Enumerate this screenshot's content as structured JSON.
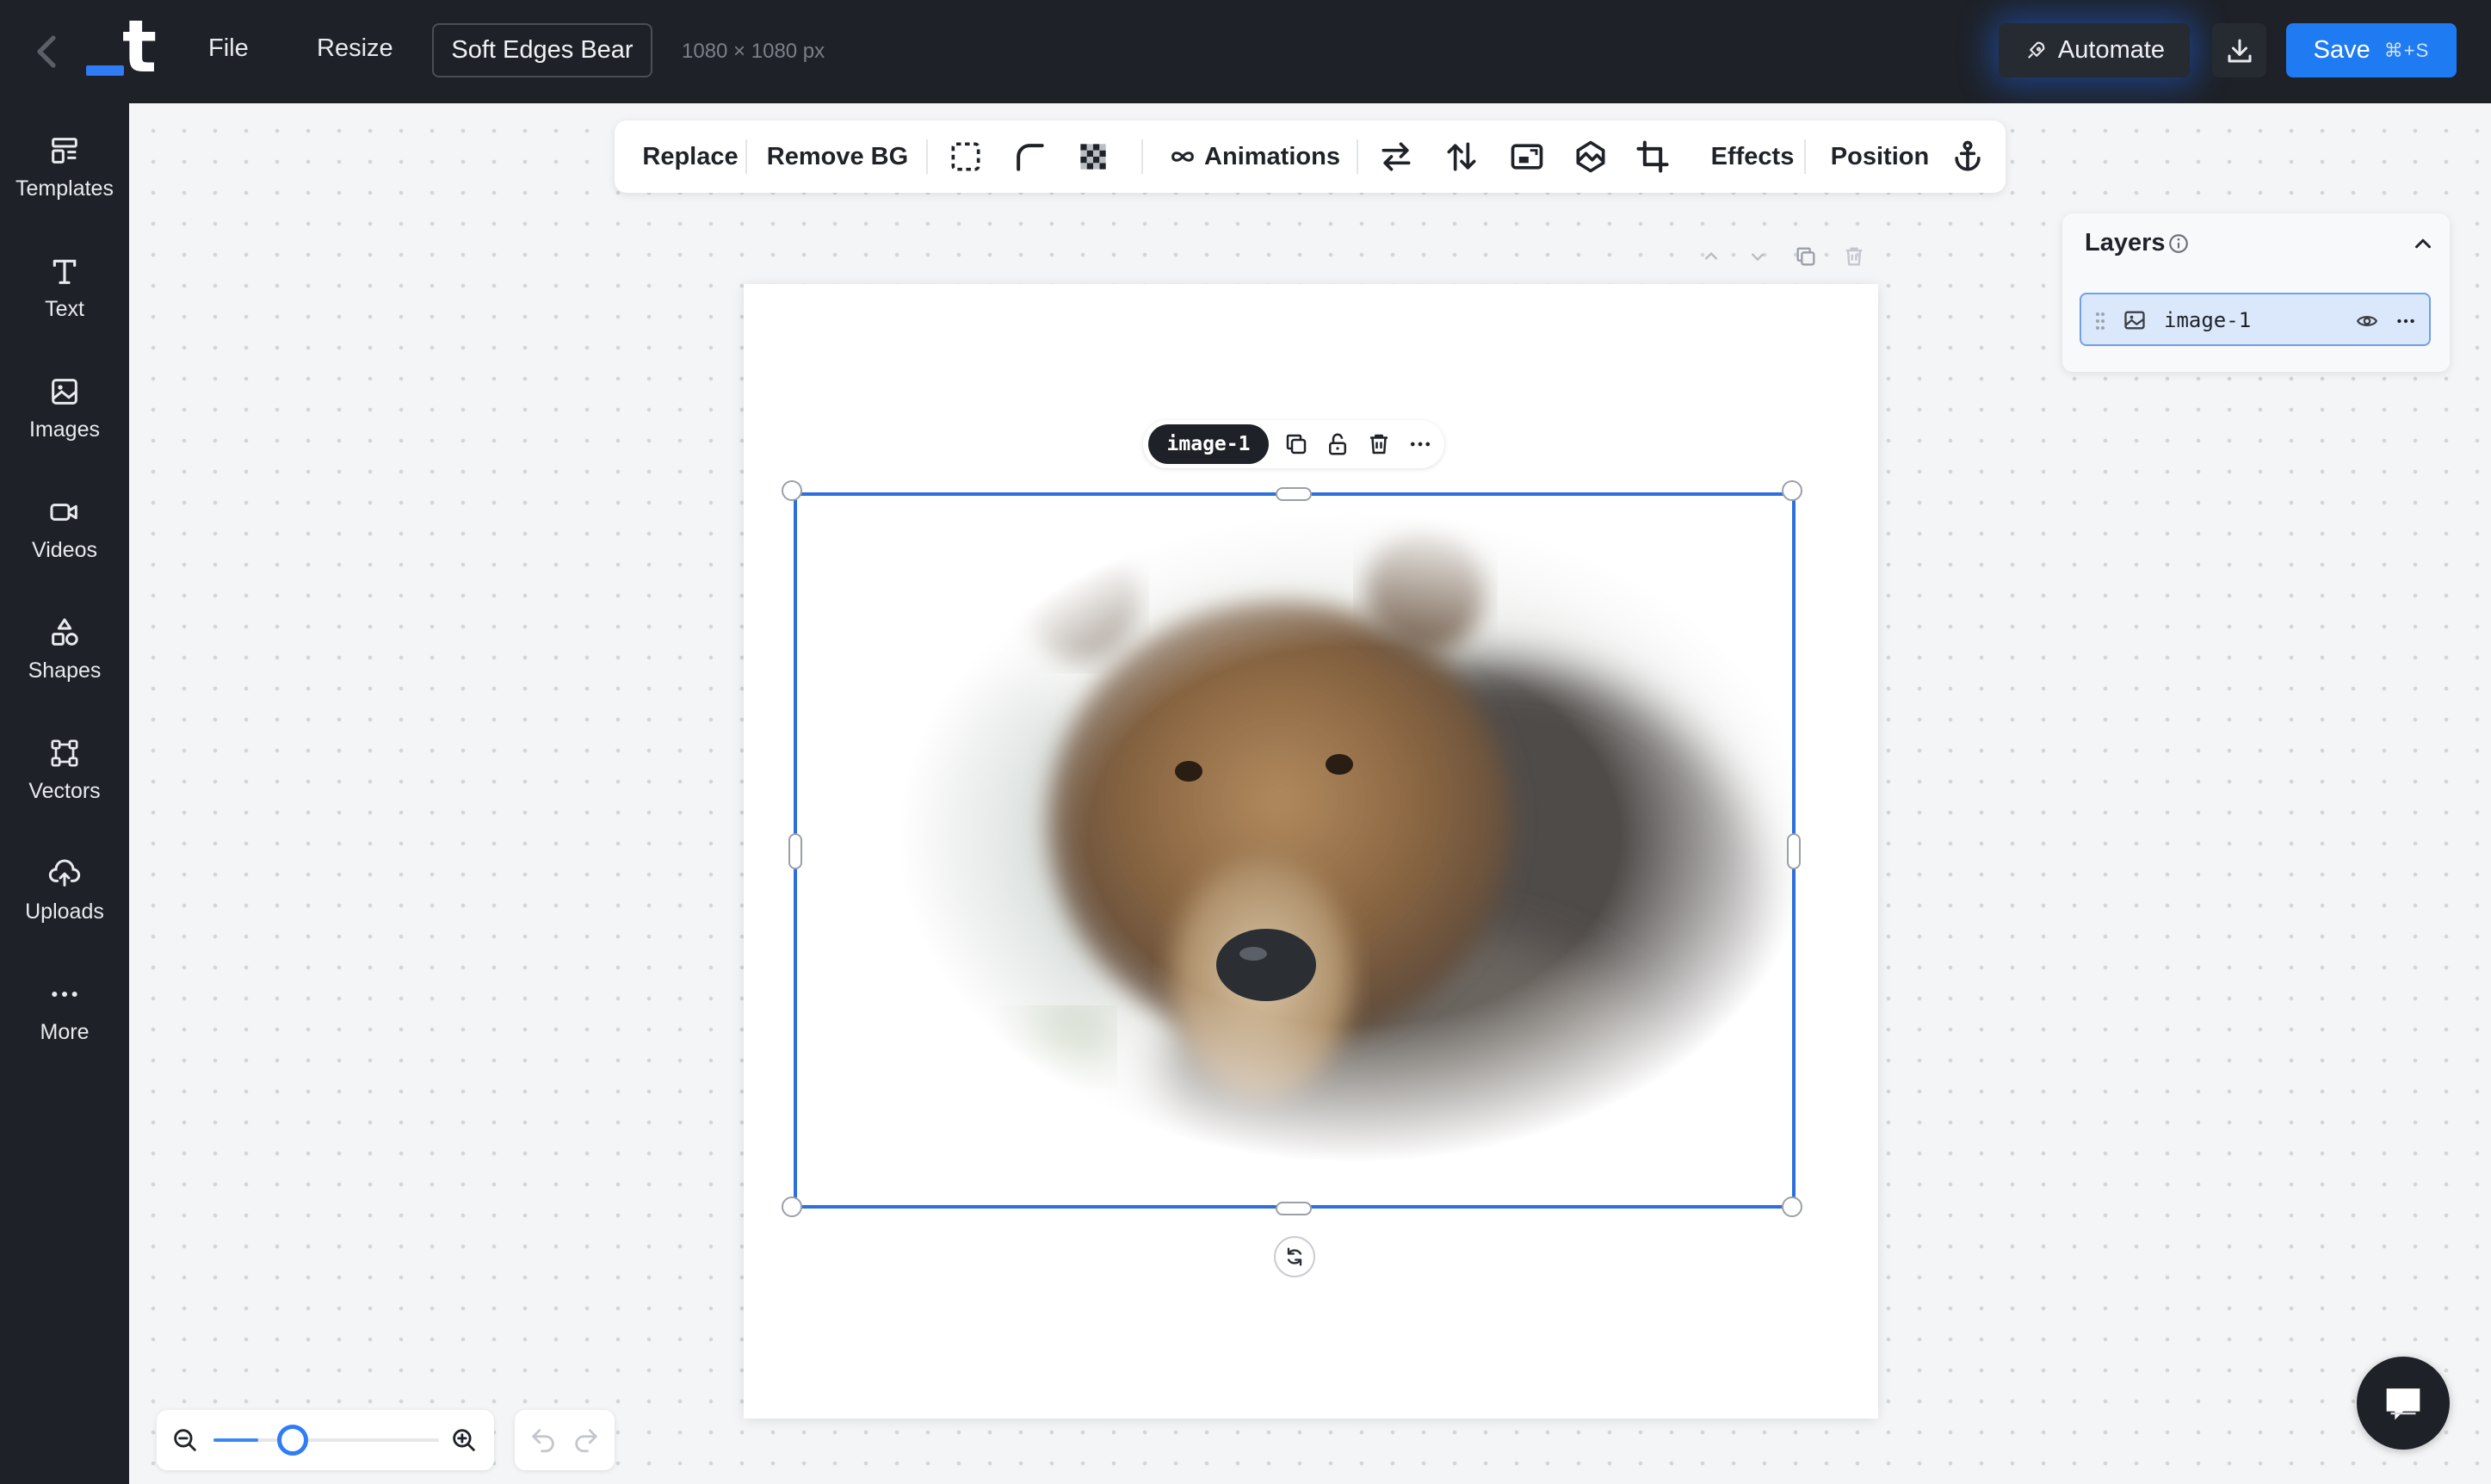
{
  "topbar": {
    "menu": {
      "file": "File",
      "resize": "Resize"
    },
    "document_title": "Soft Edges Bear",
    "document_size": "1080 × 1080 px",
    "automate_label": "Automate",
    "save_label": "Save",
    "save_shortcut": "⌘+S"
  },
  "sidebar": {
    "items": [
      {
        "label": "Templates",
        "icon": "templates-icon"
      },
      {
        "label": "Text",
        "icon": "text-icon"
      },
      {
        "label": "Images",
        "icon": "image-icon"
      },
      {
        "label": "Videos",
        "icon": "video-icon"
      },
      {
        "label": "Shapes",
        "icon": "shapes-icon"
      },
      {
        "label": "Vectors",
        "icon": "vector-icon"
      },
      {
        "label": "Uploads",
        "icon": "upload-icon"
      },
      {
        "label": "More",
        "icon": "more-icon"
      }
    ]
  },
  "toolbar": {
    "replace": "Replace",
    "remove_bg": "Remove BG",
    "animations": "Animations",
    "effects": "Effects",
    "position": "Position"
  },
  "element": {
    "name": "image-1"
  },
  "layers": {
    "title": "Layers",
    "items": [
      {
        "name": "image-1"
      }
    ]
  },
  "zoom": {
    "level": 0.2
  },
  "colors": {
    "accent": "#1f7bf2",
    "chrome": "#1e2127",
    "selection": "#2d6fdc"
  }
}
